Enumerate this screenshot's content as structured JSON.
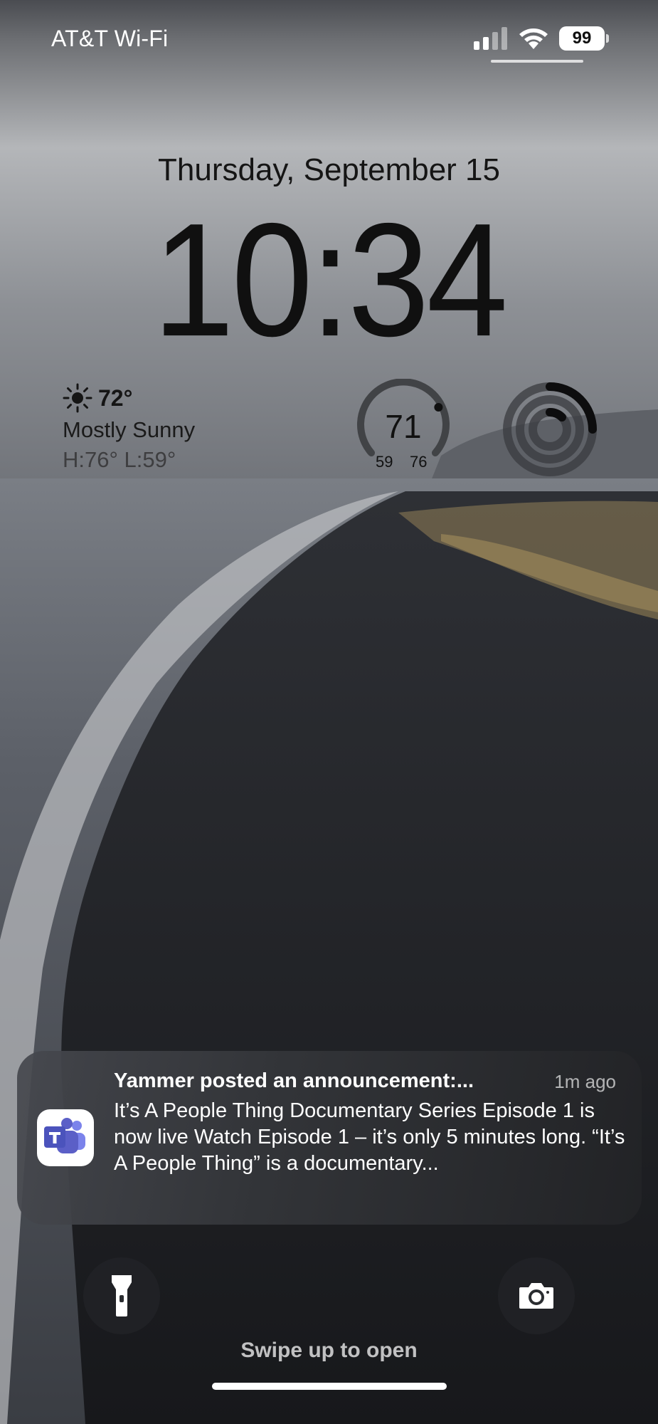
{
  "status_bar": {
    "carrier": "AT&T Wi-Fi",
    "battery_level": "99",
    "signal_icon": "cellular-signal-icon",
    "wifi_icon": "wifi-icon"
  },
  "lock_screen": {
    "date": "Thursday, September 15",
    "time": "10:34"
  },
  "widgets": {
    "weather": {
      "icon": "sun-icon",
      "temperature": "72°",
      "condition": "Mostly Sunny",
      "high_low": "H:76° L:59°"
    },
    "temperature_gauge": {
      "current": "71",
      "low": "59",
      "high": "76",
      "position_fraction": 0.71
    },
    "activity_rings": {
      "icon": "activity-rings-icon"
    }
  },
  "notification": {
    "app_icon": "teams-icon",
    "title": "Yammer posted an announcement:...",
    "time_ago": "1m ago",
    "body": "It’s A People Thing Documentary Series Episode 1 is now live Watch Episode 1 – it’s only 5 minutes long. “It’s A People Thing” is a documentary..."
  },
  "quick_actions": {
    "flashlight_icon": "flashlight-icon",
    "camera_icon": "camera-icon"
  },
  "footer": {
    "swipe_hint": "Swipe up to open"
  },
  "colors": {
    "teams_purple": "#5b5fc7",
    "notification_bg": "#3a3b3f"
  }
}
